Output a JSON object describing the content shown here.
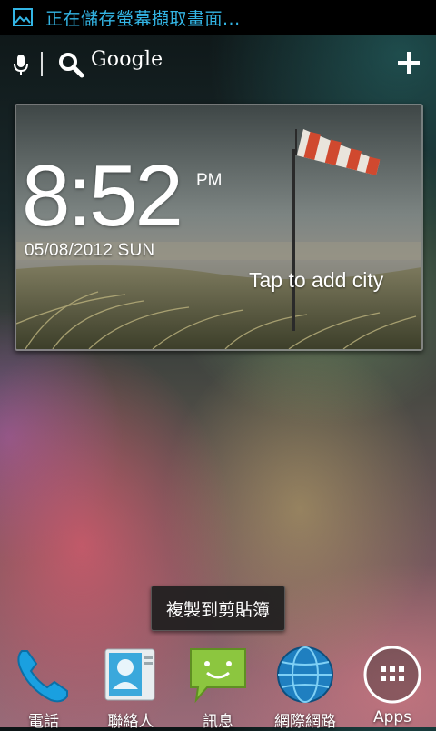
{
  "status_bar": {
    "notification_text": "正在儲存螢幕擷取畫面...",
    "accent_color": "#33b5e5",
    "icon": "image-icon"
  },
  "search_bar": {
    "label": "Google",
    "mic_icon": "mic-icon",
    "search_icon": "search-icon",
    "add_icon": "plus-icon"
  },
  "clock_widget": {
    "time": "8:52",
    "ampm": "PM",
    "date": "05/08/2012 SUN",
    "city_prompt": "Tap to add city",
    "background": "windsock-beach-scene"
  },
  "toast": {
    "text": "複製到剪貼簿"
  },
  "dock": {
    "items": [
      {
        "label": "電話",
        "icon": "phone-icon"
      },
      {
        "label": "聯絡人",
        "icon": "contacts-icon"
      },
      {
        "label": "訊息",
        "icon": "messaging-icon"
      },
      {
        "label": "網際網路",
        "icon": "browser-globe-icon"
      },
      {
        "label": "Apps",
        "icon": "apps-grid-icon"
      }
    ]
  }
}
